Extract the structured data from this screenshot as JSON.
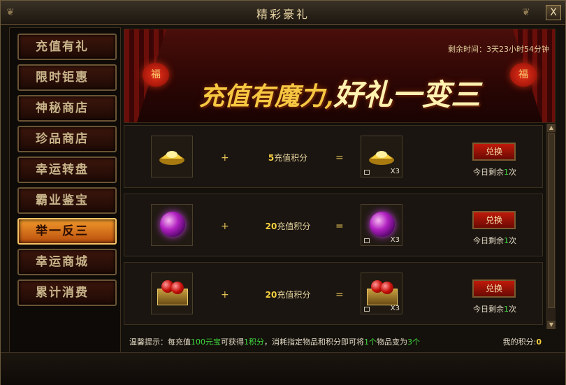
{
  "window": {
    "title": "精彩豪礼",
    "close_label": "X"
  },
  "sidebar": {
    "items": [
      {
        "label": "充值有礼",
        "active": false
      },
      {
        "label": "限时钜惠",
        "active": false
      },
      {
        "label": "神秘商店",
        "active": false
      },
      {
        "label": "珍品商店",
        "active": false
      },
      {
        "label": "幸运转盘",
        "active": false
      },
      {
        "label": "霸业鉴宝",
        "active": false
      },
      {
        "label": "举一反三",
        "active": true
      },
      {
        "label": "幸运商城",
        "active": false
      },
      {
        "label": "累计消费",
        "active": false
      }
    ]
  },
  "banner": {
    "timer_label": "剩余时间：",
    "timer_value": "3天23小时54分钟",
    "slogan_part1": "充值有魔力,",
    "slogan_part2": "好礼一变三",
    "lantern_char": "福"
  },
  "rows": [
    {
      "item": "gold-ingot",
      "points_value": "5",
      "points_label": "充值积分",
      "result_count": "X3",
      "button": "兑换",
      "remain_prefix": "今日剩余",
      "remain_value": "1",
      "remain_suffix": "次"
    },
    {
      "item": "purple-orb",
      "points_value": "20",
      "points_label": "充值积分",
      "result_count": "X3",
      "button": "兑换",
      "remain_prefix": "今日剩余",
      "remain_value": "1",
      "remain_suffix": "次"
    },
    {
      "item": "red-gem-box",
      "points_value": "20",
      "points_label": "充值积分",
      "result_count": "X3",
      "button": "兑换",
      "remain_prefix": "今日剩余",
      "remain_value": "1",
      "remain_suffix": "次"
    }
  ],
  "symbols": {
    "plus": "+",
    "equals": "="
  },
  "footer": {
    "tip_1": "温馨提示：每充值",
    "tip_2": "100元宝",
    "tip_3": "可获得",
    "tip_4": "1积分",
    "tip_5": "，消耗指定物品和积分即可将",
    "tip_6": "1个",
    "tip_7": "物品变为",
    "tip_8": "3个",
    "my_points_label": "我的积分:",
    "my_points_value": "0"
  },
  "colors": {
    "accent_gold": "#f6d040",
    "highlight_green": "#3fd83f",
    "active_tab": "#f29a2c",
    "button_red": "#c01a0a"
  }
}
